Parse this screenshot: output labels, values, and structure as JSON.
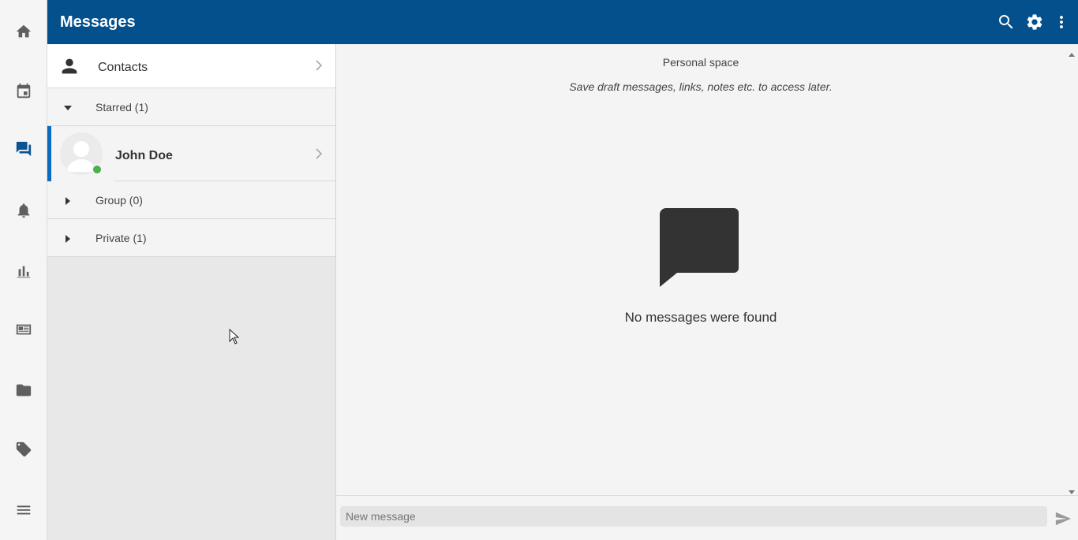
{
  "header": {
    "title": "Messages",
    "search_icon": "search-icon",
    "settings_icon": "gear-icon",
    "more_icon": "more-vert-icon",
    "background": "#03508c"
  },
  "rail": {
    "items": [
      {
        "name": "home-icon",
        "active": false
      },
      {
        "name": "calendar-icon",
        "active": false
      },
      {
        "name": "messages-icon",
        "active": true
      },
      {
        "name": "bell-icon",
        "active": false
      },
      {
        "name": "bar-chart-icon",
        "active": false
      },
      {
        "name": "newspaper-icon",
        "active": false
      },
      {
        "name": "folder-icon",
        "active": false
      },
      {
        "name": "tag-icon",
        "active": false
      },
      {
        "name": "menu-icon",
        "active": false
      }
    ],
    "active_color": "#0a5394"
  },
  "panel": {
    "contacts_label": "Contacts",
    "groups": {
      "starred": {
        "label": "Starred (1)",
        "expanded": true
      },
      "group": {
        "label": "Group (0)",
        "expanded": false
      },
      "private": {
        "label": "Private (1)",
        "expanded": false
      }
    },
    "starred_contacts": [
      {
        "name": "John Doe",
        "status": "online",
        "status_color": "#4caf50",
        "selected": true
      }
    ]
  },
  "main": {
    "title": "Personal space",
    "subtitle": "Save draft messages, links, notes etc. to access later.",
    "empty_text": "No messages were found",
    "empty_icon": "chat-bubbles-icon"
  },
  "composer": {
    "placeholder": "New message",
    "value": "",
    "send_icon": "send-icon"
  }
}
